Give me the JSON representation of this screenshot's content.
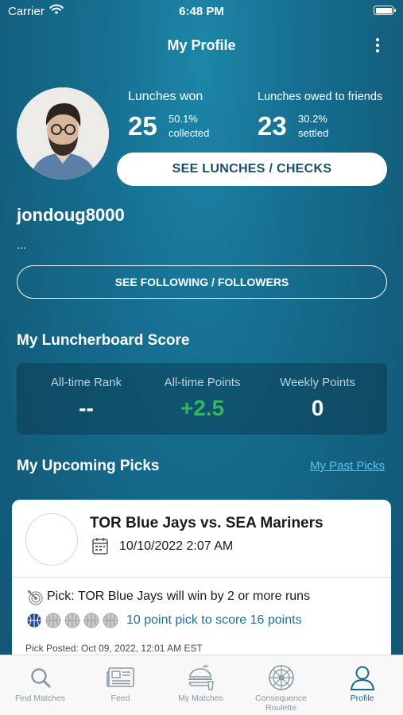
{
  "status_bar": {
    "carrier": "Carrier",
    "time": "6:48 PM"
  },
  "header": {
    "title": "My Profile"
  },
  "stats": {
    "lunches_won": {
      "label": "Lunches won",
      "value": "25",
      "pct": "50.1%",
      "pct_label": "collected"
    },
    "lunches_owed": {
      "label": "Lunches owed to friends",
      "value": "23",
      "pct": "30.2%",
      "pct_label": "settled"
    }
  },
  "buttons": {
    "see_lunches": "SEE LUNCHES / CHECKS",
    "see_following": "SEE FOLLOWING / FOLLOWERS"
  },
  "profile": {
    "username": "jondoug8000",
    "bio": "..."
  },
  "luncherboard": {
    "title": "My Luncherboard Score",
    "rank_label": "All-time Rank",
    "rank_value": "--",
    "points_label": "All-time Points",
    "points_value": "+2.5",
    "weekly_label": "Weekly Points",
    "weekly_value": "0",
    "points_color": "#34b561"
  },
  "upcoming": {
    "title": "My Upcoming Picks",
    "past_link": "My Past Picks",
    "card": {
      "match": "TOR Blue Jays vs. SEA Mariners",
      "date": "10/10/2022 2:07 AM",
      "pick": "Pick: TOR Blue Jays will win by 2 or more runs",
      "points": "10 point pick to score 16 points",
      "posted": "Pick Posted: Oct 09, 2022, 12:01 AM EST",
      "balls_filled": 1,
      "balls_total": 5
    }
  },
  "tabs": [
    {
      "label": "Find Matches",
      "icon": "search-icon"
    },
    {
      "label": "Feed",
      "icon": "newspaper-icon"
    },
    {
      "label": "My Matches",
      "icon": "lunch-icon"
    },
    {
      "label": "Consequence Roulette",
      "icon": "roulette-wheel-icon"
    },
    {
      "label": "Profile",
      "icon": "person-icon",
      "active": true
    }
  ],
  "colors": {
    "background": "#166f91",
    "accent": "#166c91",
    "link": "#5fc0ea"
  }
}
